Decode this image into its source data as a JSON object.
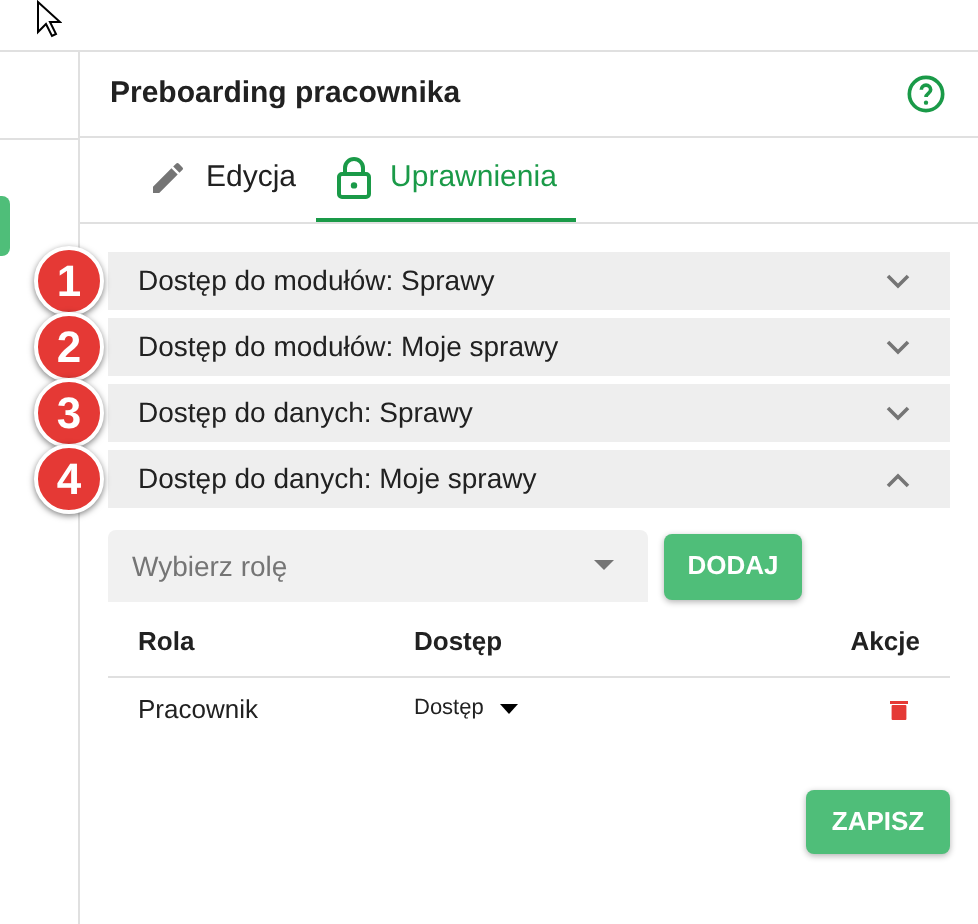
{
  "panel": {
    "title": "Preboarding pracownika"
  },
  "tabs": [
    {
      "label": "Edycja",
      "selected": false
    },
    {
      "label": "Uprawnienia",
      "selected": true
    }
  ],
  "sections": [
    {
      "number": "1",
      "title": "Dostęp do modułów: Sprawy",
      "expanded": false
    },
    {
      "number": "2",
      "title": "Dostęp do modułów: Moje sprawy",
      "expanded": false
    },
    {
      "number": "3",
      "title": "Dostęp do danych: Sprawy",
      "expanded": false
    },
    {
      "number": "4",
      "title": "Dostęp do danych: Moje sprawy",
      "expanded": true
    }
  ],
  "role_select": {
    "placeholder": "Wybierz rolę"
  },
  "add_button": "DODAJ",
  "table": {
    "columns": [
      "Rola",
      "Dostęp",
      "Akcje"
    ],
    "rows": [
      {
        "role": "Pracownik",
        "access": "Dostęp"
      }
    ]
  },
  "save_button": "ZAPISZ"
}
